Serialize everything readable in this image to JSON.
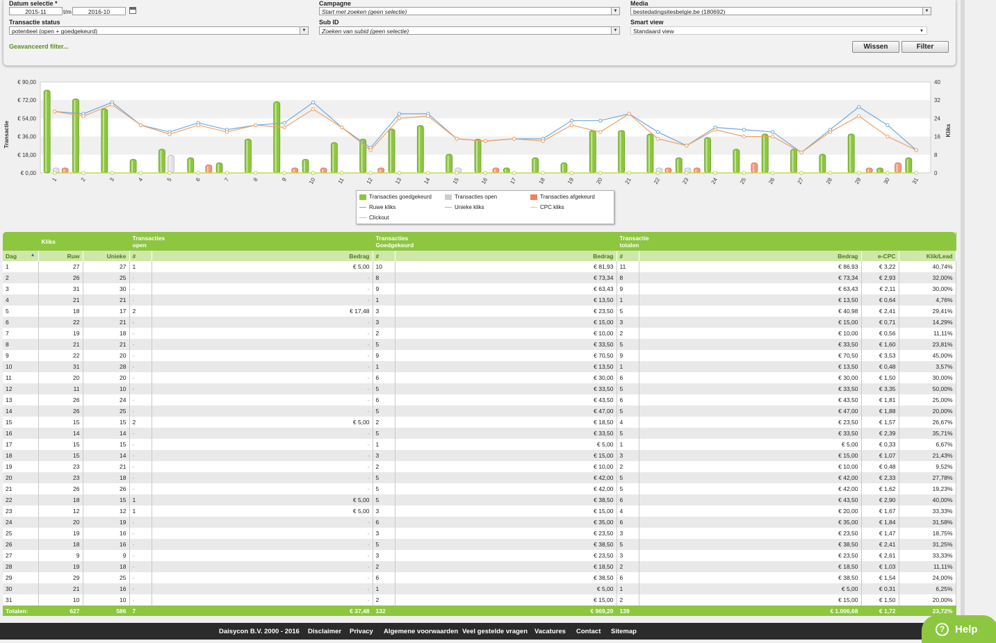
{
  "filters": {
    "datum_label": "Datum selectie *",
    "date_from": "2015-11",
    "date_sep": "t/m",
    "date_to": "2016-10",
    "campagne_label": "Campagne",
    "campagne_value": "Start met zoeken (geen selectie)",
    "media_label": "Media",
    "media_value": "bestedatingsitesbelgie.be (180692)",
    "status_label": "Transactie status",
    "status_value": "potentieel (open + goedgekeurd)",
    "subid_label": "Sub ID",
    "subid_value": "Zoeken van subid (geen selectie)",
    "smartview_label": "Smart view",
    "smartview_value": "Standaard view",
    "advanced_link": "Geavanceerd filter...",
    "wissen_button": "Wissen",
    "filter_button": "Filter"
  },
  "chart": {
    "left_ticks": [
      "€ 90,00",
      "€ 72,00",
      "€ 54,00",
      "€ 36,00",
      "€ 18,00",
      "€ 0,00"
    ],
    "right_ticks": [
      "40",
      "32",
      "24",
      "16",
      "8",
      "0"
    ],
    "left_axis_label": "Transactie",
    "right_axis_label": "Kliks"
  },
  "chart_data": {
    "type": "bar",
    "categories": [
      "1",
      "2",
      "3",
      "4",
      "5",
      "6",
      "7",
      "8",
      "9",
      "10",
      "11",
      "12",
      "13",
      "14",
      "15",
      "16",
      "17",
      "18",
      "19",
      "20",
      "21",
      "22",
      "23",
      "24",
      "25",
      "26",
      "27",
      "28",
      "29",
      "30",
      "31"
    ],
    "left_axis": {
      "label": "Transactie",
      "range": [
        0,
        90
      ]
    },
    "right_axis": {
      "label": "Kliks",
      "range": [
        0,
        40
      ]
    },
    "grid": true,
    "legend_position": "bottom",
    "series": [
      {
        "name": "Transacties goedgekeurd",
        "type": "bar",
        "axis": "left",
        "color": "#8cc63f",
        "values": [
          81.93,
          73.34,
          63.43,
          13.5,
          23.5,
          15,
          10,
          33.5,
          70.5,
          13.5,
          30,
          33.5,
          43.5,
          47,
          18.5,
          33.5,
          5,
          15,
          10,
          42,
          42,
          38.5,
          15,
          35,
          23.5,
          38.5,
          23.5,
          18.5,
          38.5,
          5,
          15
        ]
      },
      {
        "name": "Transacties open",
        "type": "bar",
        "axis": "left",
        "color": "#d0d0d0",
        "values": [
          5,
          0,
          0,
          0,
          17.48,
          0,
          0,
          0,
          0,
          0,
          0,
          0,
          0,
          0,
          5,
          0,
          0,
          0,
          0,
          0,
          0,
          5,
          5,
          0,
          0,
          0,
          0,
          0,
          0,
          0,
          0
        ]
      },
      {
        "name": "Transacties afgekeurd",
        "type": "bar",
        "axis": "left",
        "color": "#f08060",
        "values": [
          5,
          0,
          0,
          0,
          0,
          8,
          0,
          0,
          5,
          5,
          0,
          5,
          0,
          0,
          0,
          5,
          0,
          0,
          0,
          0,
          0,
          5,
          5,
          0,
          10,
          0,
          0,
          0,
          5,
          10,
          0
        ]
      },
      {
        "name": "Ruwe kliks",
        "type": "line",
        "axis": "right",
        "color": "#6fa8dc",
        "values": [
          27,
          26,
          31,
          21,
          18,
          22,
          19,
          21,
          22,
          31,
          20,
          11,
          26,
          26,
          15,
          14,
          15,
          15,
          23,
          23,
          26,
          18,
          12,
          20,
          19,
          18,
          9,
          19,
          29,
          21,
          10
        ]
      },
      {
        "name": "Unieke kliks",
        "type": "line",
        "axis": "right",
        "color": "#f0a060",
        "values": [
          27,
          25,
          30,
          21,
          17,
          21,
          18,
          21,
          20,
          28,
          20,
          10,
          24,
          25,
          15,
          14,
          15,
          14,
          21,
          18,
          26,
          15,
          12,
          19,
          16,
          16,
          9,
          18,
          25,
          16,
          10
        ]
      },
      {
        "name": "CPC kliks",
        "type": "line",
        "axis": "right",
        "color": "#e8d040",
        "values": [
          0,
          0,
          0,
          0,
          0,
          0,
          0,
          0,
          0,
          0,
          0,
          0,
          0,
          0,
          0,
          0,
          0,
          0,
          0,
          0,
          0,
          0,
          0,
          0,
          0,
          0,
          0,
          0,
          0,
          0,
          0
        ]
      },
      {
        "name": "Clickout",
        "type": "line",
        "axis": "right",
        "color": "#b8d860",
        "values": [
          0,
          0,
          0,
          0,
          0,
          0,
          0,
          0,
          0,
          0,
          0,
          0,
          0,
          0,
          0,
          0,
          0,
          0,
          0,
          0,
          0,
          0,
          0,
          0,
          0,
          0,
          0,
          0,
          0,
          0,
          0
        ]
      }
    ]
  },
  "table": {
    "groups": {
      "kliks": "Kliks",
      "open_1": "Transacties",
      "open_2": "open",
      "goed_1": "Transacties",
      "goed_2": "Goedgekeurd",
      "tot_1": "Transactie",
      "tot_2": "totalen"
    },
    "headers": {
      "dag": "Dag",
      "ruw": "Ruw",
      "unieke": "Unieke",
      "open_n": "#",
      "open_bedrag": "Bedrag",
      "goed_n": "#",
      "goed_bedrag": "Bedrag",
      "tot_n": "#",
      "tot_bedrag": "Bedrag",
      "ecpc": "e-CPC",
      "kliklead": "Klik/Lead"
    },
    "rows": [
      [
        "1",
        "27",
        "27",
        "1",
        "€ 5,00",
        "10",
        "€ 81,93",
        "11",
        "€ 86,93",
        "€ 3,22",
        "40,74%"
      ],
      [
        "2",
        "26",
        "25",
        "-",
        "-",
        "8",
        "€ 73,34",
        "8",
        "€ 73,34",
        "€ 2,93",
        "32,00%"
      ],
      [
        "3",
        "31",
        "30",
        "-",
        "-",
        "9",
        "€ 63,43",
        "9",
        "€ 63,43",
        "€ 2,11",
        "30,00%"
      ],
      [
        "4",
        "21",
        "21",
        "-",
        "-",
        "1",
        "€ 13,50",
        "1",
        "€ 13,50",
        "€ 0,64",
        "4,76%"
      ],
      [
        "5",
        "18",
        "17",
        "2",
        "€ 17,48",
        "3",
        "€ 23,50",
        "5",
        "€ 40,98",
        "€ 2,41",
        "29,41%"
      ],
      [
        "6",
        "22",
        "21",
        "-",
        "-",
        "3",
        "€ 15,00",
        "3",
        "€ 15,00",
        "€ 0,71",
        "14,29%"
      ],
      [
        "7",
        "19",
        "18",
        "-",
        "-",
        "2",
        "€ 10,00",
        "2",
        "€ 10,00",
        "€ 0,56",
        "11,11%"
      ],
      [
        "8",
        "21",
        "21",
        "-",
        "-",
        "5",
        "€ 33,50",
        "5",
        "€ 33,50",
        "€ 1,60",
        "23,81%"
      ],
      [
        "9",
        "22",
        "20",
        "-",
        "-",
        "9",
        "€ 70,50",
        "9",
        "€ 70,50",
        "€ 3,53",
        "45,00%"
      ],
      [
        "10",
        "31",
        "28",
        "-",
        "-",
        "1",
        "€ 13,50",
        "1",
        "€ 13,50",
        "€ 0,48",
        "3,57%"
      ],
      [
        "11",
        "20",
        "20",
        "-",
        "-",
        "6",
        "€ 30,00",
        "6",
        "€ 30,00",
        "€ 1,50",
        "30,00%"
      ],
      [
        "12",
        "11",
        "10",
        "-",
        "-",
        "5",
        "€ 33,50",
        "5",
        "€ 33,50",
        "€ 3,35",
        "50,00%"
      ],
      [
        "13",
        "26",
        "24",
        "-",
        "-",
        "6",
        "€ 43,50",
        "6",
        "€ 43,50",
        "€ 1,81",
        "25,00%"
      ],
      [
        "14",
        "26",
        "25",
        "-",
        "-",
        "5",
        "€ 47,00",
        "5",
        "€ 47,00",
        "€ 1,88",
        "20,00%"
      ],
      [
        "15",
        "15",
        "15",
        "2",
        "€ 5,00",
        "2",
        "€ 18,50",
        "4",
        "€ 23,50",
        "€ 1,57",
        "26,67%"
      ],
      [
        "16",
        "14",
        "14",
        "-",
        "-",
        "5",
        "€ 33,50",
        "5",
        "€ 33,50",
        "€ 2,39",
        "35,71%"
      ],
      [
        "17",
        "15",
        "15",
        "-",
        "-",
        "1",
        "€ 5,00",
        "1",
        "€ 5,00",
        "€ 0,33",
        "6,67%"
      ],
      [
        "18",
        "15",
        "14",
        "-",
        "-",
        "3",
        "€ 15,00",
        "3",
        "€ 15,00",
        "€ 1,07",
        "21,43%"
      ],
      [
        "19",
        "23",
        "21",
        "-",
        "-",
        "2",
        "€ 10,00",
        "2",
        "€ 10,00",
        "€ 0,48",
        "9,52%"
      ],
      [
        "20",
        "23",
        "18",
        "-",
        "-",
        "5",
        "€ 42,00",
        "5",
        "€ 42,00",
        "€ 2,33",
        "27,78%"
      ],
      [
        "21",
        "26",
        "26",
        "-",
        "-",
        "5",
        "€ 42,00",
        "5",
        "€ 42,00",
        "€ 1,62",
        "19,23%"
      ],
      [
        "22",
        "18",
        "15",
        "1",
        "€ 5,00",
        "5",
        "€ 38,50",
        "6",
        "€ 43,50",
        "€ 2,90",
        "40,00%"
      ],
      [
        "23",
        "12",
        "12",
        "1",
        "€ 5,00",
        "3",
        "€ 15,00",
        "4",
        "€ 20,00",
        "€ 1,67",
        "33,33%"
      ],
      [
        "24",
        "20",
        "19",
        "-",
        "-",
        "6",
        "€ 35,00",
        "6",
        "€ 35,00",
        "€ 1,84",
        "31,58%"
      ],
      [
        "25",
        "19",
        "16",
        "-",
        "-",
        "3",
        "€ 23,50",
        "3",
        "€ 23,50",
        "€ 1,47",
        "18,75%"
      ],
      [
        "26",
        "18",
        "16",
        "-",
        "-",
        "5",
        "€ 38,50",
        "5",
        "€ 38,50",
        "€ 2,41",
        "31,25%"
      ],
      [
        "27",
        "9",
        "9",
        "-",
        "-",
        "3",
        "€ 23,50",
        "3",
        "€ 23,50",
        "€ 2,61",
        "33,33%"
      ],
      [
        "28",
        "19",
        "18",
        "-",
        "-",
        "2",
        "€ 18,50",
        "2",
        "€ 18,50",
        "€ 1,03",
        "11,11%"
      ],
      [
        "29",
        "29",
        "25",
        "-",
        "-",
        "6",
        "€ 38,50",
        "6",
        "€ 38,50",
        "€ 1,54",
        "24,00%"
      ],
      [
        "30",
        "21",
        "16",
        "-",
        "-",
        "1",
        "€ 5,00",
        "1",
        "€ 5,00",
        "€ 0,31",
        "6,25%"
      ],
      [
        "31",
        "10",
        "10",
        "-",
        "-",
        "2",
        "€ 15,00",
        "2",
        "€ 15,00",
        "€ 1,50",
        "20,00%"
      ]
    ],
    "totals": [
      "Totalen:",
      "627",
      "586",
      "7",
      "€ 37,48",
      "132",
      "€ 969,20",
      "139",
      "€ 1.006,68",
      "€ 1,72",
      "23,72%"
    ]
  },
  "footer": {
    "copyright": "Daisycon B.V. 2000 - 2016",
    "links": [
      "Disclaimer",
      "Privacy",
      "Algemene voorwaarden",
      "Veel gestelde vragen",
      "Vacatures",
      "Contact",
      "Sitemap"
    ]
  },
  "help": {
    "label": "Help"
  }
}
